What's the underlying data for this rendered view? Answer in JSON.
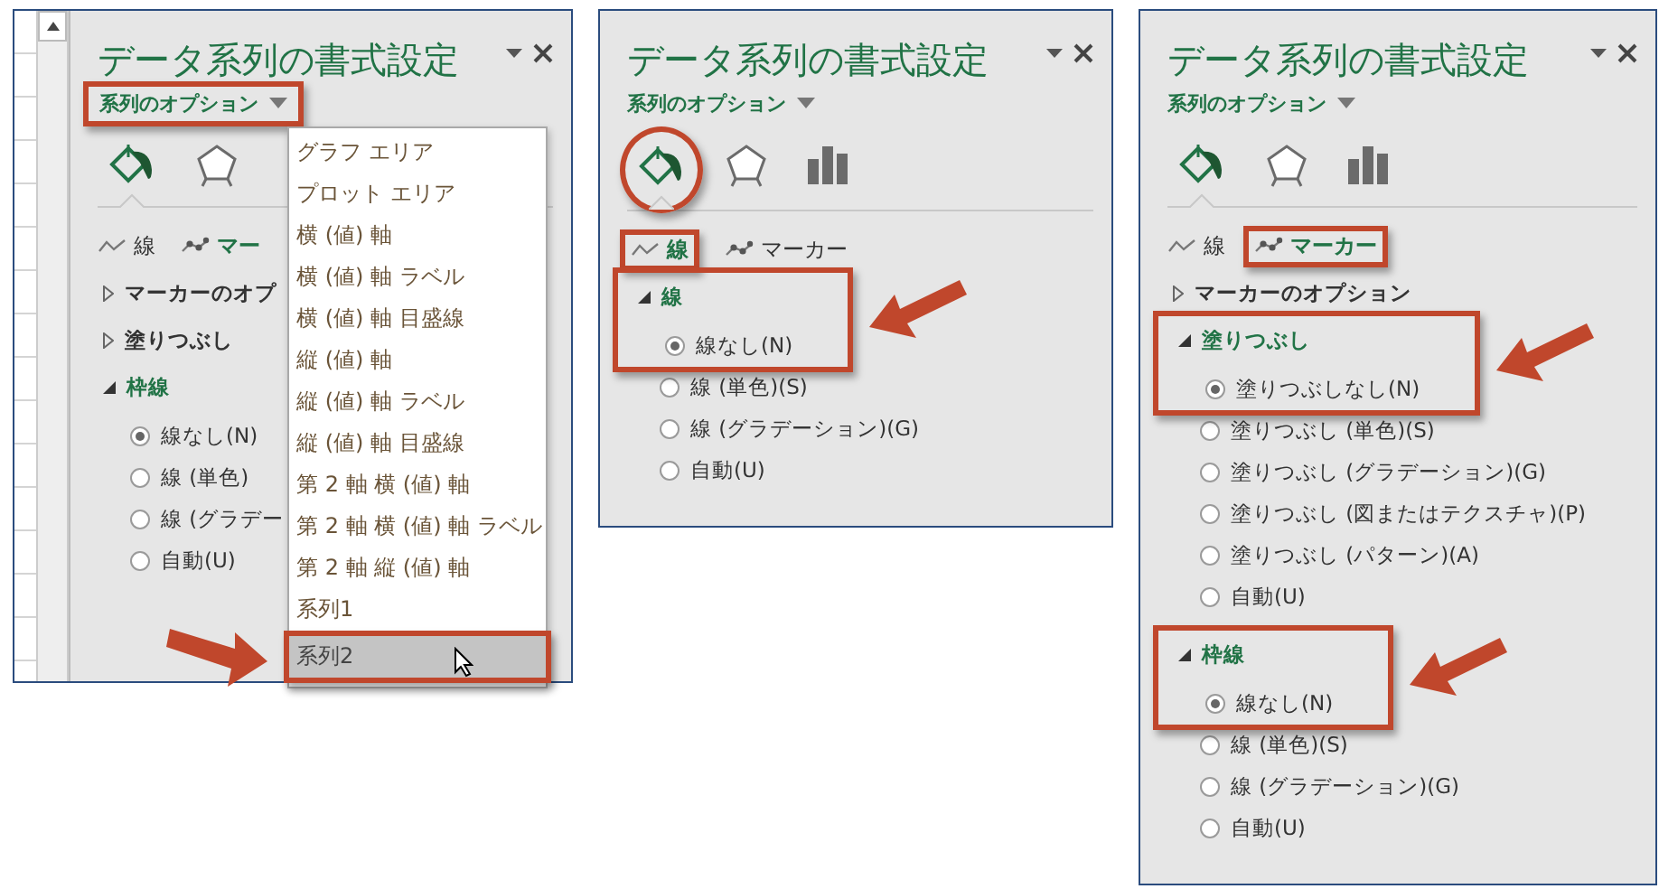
{
  "panels": [
    {
      "sheet_edge": true,
      "title": "データ系列の書式設定",
      "options_menu": {
        "label": "系列のオプション",
        "highlighted": true
      },
      "icon_tabs": [
        {
          "kind": "fill",
          "selected": true,
          "highlighted": false
        },
        {
          "kind": "effects",
          "selected": false,
          "highlighted": false
        }
      ],
      "sub_tabs": [
        {
          "kind": "line",
          "label": "線",
          "selected": false,
          "highlighted": false
        },
        {
          "kind": "marker",
          "label": "マー",
          "selected": true,
          "highlighted": false
        }
      ],
      "sections": [
        {
          "label": "マーカーのオプ",
          "expanded": false,
          "highlighted": false,
          "arrow": false
        },
        {
          "label": "塗りつぶし",
          "expanded": false,
          "highlighted": false,
          "arrow": false
        },
        {
          "label": "枠線",
          "expanded": true,
          "highlighted": false,
          "arrow": false,
          "options": [
            {
              "label": "線なし(N)",
              "selected": true
            },
            {
              "label": "線 (単色)",
              "selected": false
            },
            {
              "label": "線 (グラデー",
              "selected": false
            },
            {
              "label": "自動(U)",
              "selected": false
            }
          ]
        }
      ],
      "dropdown": {
        "items": [
          {
            "label": "グラフ エリア",
            "selected": false,
            "highlighted": false,
            "arrow": false,
            "hovered": false
          },
          {
            "label": "プロット エリア",
            "selected": false,
            "highlighted": false,
            "arrow": false,
            "hovered": false
          },
          {
            "label": "横 (値) 軸",
            "selected": false,
            "highlighted": false,
            "arrow": false,
            "hovered": false
          },
          {
            "label": "横 (値) 軸 ラベル",
            "selected": false,
            "highlighted": false,
            "arrow": false,
            "hovered": false
          },
          {
            "label": "横 (値) 軸 目盛線",
            "selected": false,
            "highlighted": false,
            "arrow": false,
            "hovered": false
          },
          {
            "label": "縦 (値) 軸",
            "selected": false,
            "highlighted": false,
            "arrow": false,
            "hovered": false
          },
          {
            "label": "縦 (値) 軸 ラベル",
            "selected": false,
            "highlighted": false,
            "arrow": false,
            "hovered": false
          },
          {
            "label": "縦 (値) 軸 目盛線",
            "selected": false,
            "highlighted": false,
            "arrow": false,
            "hovered": false
          },
          {
            "label": "第 2 軸 横 (値) 軸",
            "selected": false,
            "highlighted": false,
            "arrow": false,
            "hovered": false
          },
          {
            "label": "第 2 軸 横 (値) 軸 ラベル",
            "selected": false,
            "highlighted": false,
            "arrow": false,
            "hovered": false
          },
          {
            "label": "第 2 軸 縦 (値) 軸",
            "selected": false,
            "highlighted": false,
            "arrow": false,
            "hovered": false
          },
          {
            "label": "系列1",
            "selected": false,
            "highlighted": false,
            "arrow": false,
            "hovered": false
          },
          {
            "label": "系列2",
            "selected": true,
            "highlighted": true,
            "arrow": true,
            "hovered": true
          }
        ]
      }
    },
    {
      "sheet_edge": false,
      "title": "データ系列の書式設定",
      "options_menu": {
        "label": "系列のオプション",
        "highlighted": false
      },
      "icon_tabs": [
        {
          "kind": "fill",
          "selected": true,
          "highlighted": true
        },
        {
          "kind": "effects",
          "selected": false,
          "highlighted": false
        },
        {
          "kind": "series",
          "selected": false,
          "highlighted": false
        }
      ],
      "sub_tabs": [
        {
          "kind": "line",
          "label": "線",
          "selected": true,
          "highlighted": true
        },
        {
          "kind": "marker",
          "label": "マーカー",
          "selected": false,
          "highlighted": false
        }
      ],
      "sections": [
        {
          "label": "線",
          "expanded": true,
          "highlighted": true,
          "arrow": true,
          "options": [
            {
              "label": "線なし(N)",
              "selected": true
            },
            {
              "label": "線 (単色)(S)",
              "selected": false
            },
            {
              "label": "線 (グラデーション)(G)",
              "selected": false
            },
            {
              "label": "自動(U)",
              "selected": false
            }
          ]
        }
      ]
    },
    {
      "sheet_edge": false,
      "title": "データ系列の書式設定",
      "options_menu": {
        "label": "系列のオプション",
        "highlighted": false
      },
      "icon_tabs": [
        {
          "kind": "fill",
          "selected": true,
          "highlighted": false
        },
        {
          "kind": "effects",
          "selected": false,
          "highlighted": false
        },
        {
          "kind": "series",
          "selected": false,
          "highlighted": false
        }
      ],
      "sub_tabs": [
        {
          "kind": "line",
          "label": "線",
          "selected": false,
          "highlighted": false
        },
        {
          "kind": "marker",
          "label": "マーカー",
          "selected": true,
          "highlighted": true
        }
      ],
      "sections": [
        {
          "label": "マーカーのオプション",
          "expanded": false,
          "highlighted": false,
          "arrow": false
        },
        {
          "label": "塗りつぶし",
          "expanded": true,
          "highlighted": true,
          "arrow": true,
          "options": [
            {
              "label": "塗りつぶしなし(N)",
              "selected": true
            },
            {
              "label": "塗りつぶし (単色)(S)",
              "selected": false
            },
            {
              "label": "塗りつぶし (グラデーション)(G)",
              "selected": false
            },
            {
              "label": "塗りつぶし (図またはテクスチャ)(P)",
              "selected": false
            },
            {
              "label": "塗りつぶし (パターン)(A)",
              "selected": false
            },
            {
              "label": "自動(U)",
              "selected": false
            }
          ]
        },
        {
          "label": "枠線",
          "expanded": true,
          "highlighted": true,
          "arrow": true,
          "options": [
            {
              "label": "線なし(N)",
              "selected": true
            },
            {
              "label": "線 (単色)(S)",
              "selected": false
            },
            {
              "label": "線 (グラデーション)(G)",
              "selected": false
            },
            {
              "label": "自動(U)",
              "selected": false
            }
          ]
        }
      ]
    }
  ]
}
